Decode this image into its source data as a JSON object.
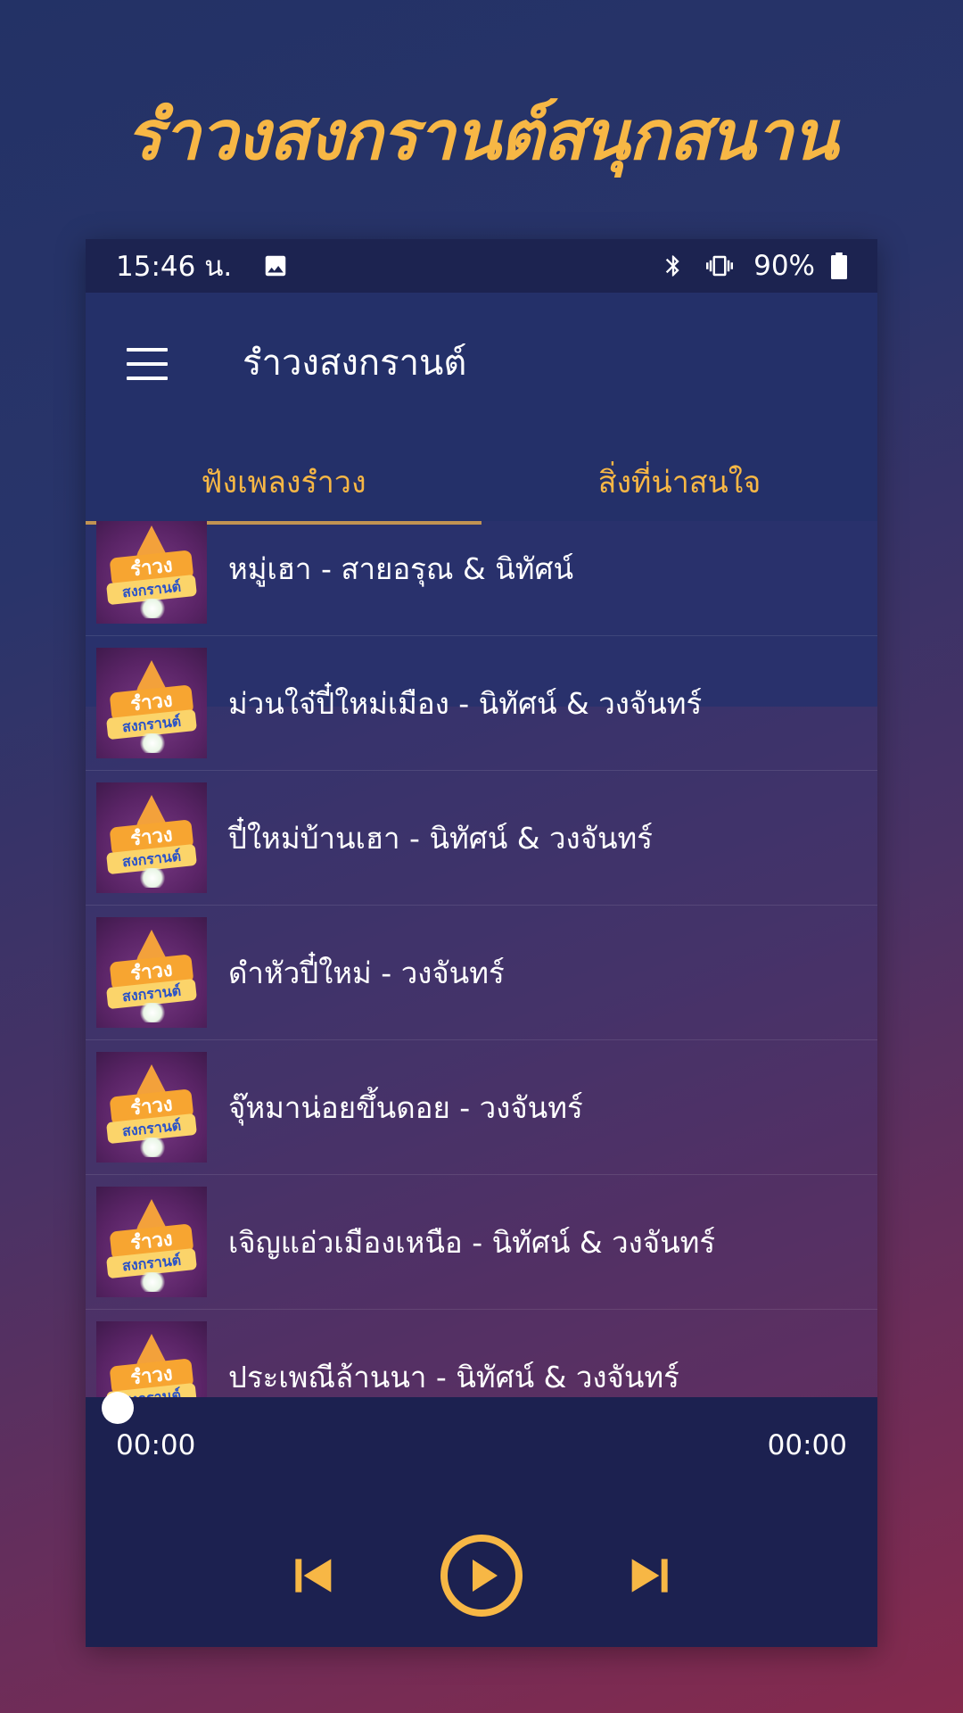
{
  "promo": {
    "title": "รำวงสงกรานต์สนุกสนาน"
  },
  "status_bar": {
    "time": "15:46 น.",
    "battery": "90%",
    "icons": [
      "image-icon",
      "bluetooth-icon",
      "vibrate-icon",
      "battery-icon"
    ]
  },
  "app_bar": {
    "title": "รำวงสงกรานต์"
  },
  "tabs": [
    {
      "label": "ฟังเพลงรำวง",
      "active": true
    },
    {
      "label": "สิ่งที่น่าสนใจ",
      "active": false
    }
  ],
  "thumbnail": {
    "line1": "รำวง",
    "line2": "สงกรานต์"
  },
  "songs": [
    {
      "title": "หมู่เฮา -  สายอรุณ & นิทัศน์"
    },
    {
      "title": "ม่วนใจ๋ปี๋ใหม่เมือง  - นิทัศน์ & วงจันทร์"
    },
    {
      "title": "ปี๋ใหม่บ้านเฮา  - นิทัศน์ & วงจันทร์"
    },
    {
      "title": "ดำหัวปี๋ใหม่ -  วงจันทร์"
    },
    {
      "title": "จุ๊หมาน่อยขึ้นดอย -  วงจันทร์"
    },
    {
      "title": "เจิญแอ่วเมืองเหนือ  - นิทัศน์ & วงจันทร์"
    },
    {
      "title": "ประเพณีล้านนา  - นิทัศน์ & วงจันทร์"
    }
  ],
  "player": {
    "current_time": "00:00",
    "total_time": "00:00",
    "progress": 0
  },
  "colors": {
    "accent": "#f7b745",
    "status_bar": "#1c2350",
    "app_bar": "#243069",
    "player": "#1c2150"
  }
}
